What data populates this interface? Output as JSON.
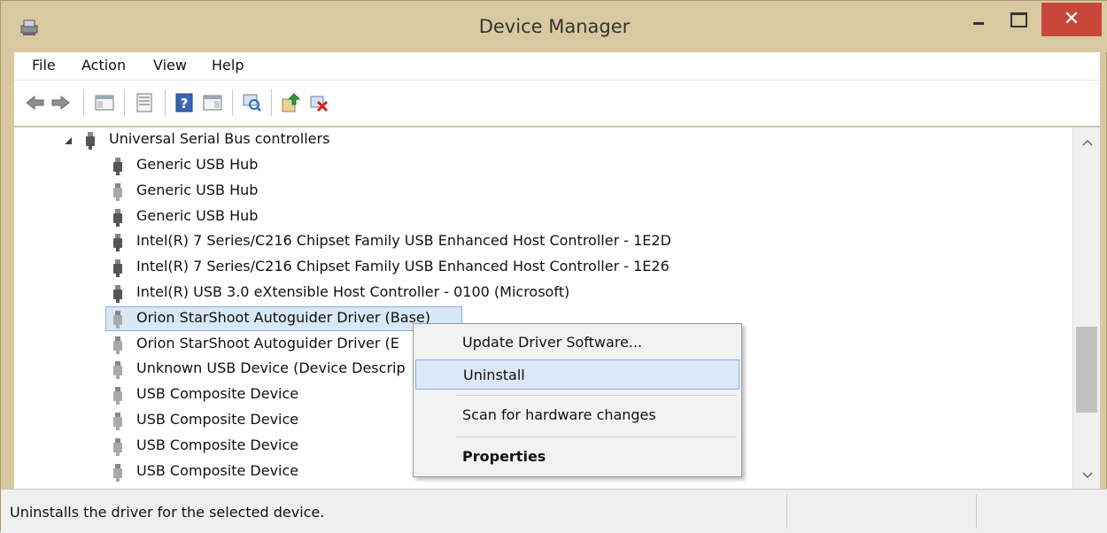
{
  "window": {
    "title": "Device Manager",
    "close_glyph": "✕"
  },
  "menu": [
    "File",
    "Action",
    "View",
    "Help"
  ],
  "toolbar": {
    "icons": [
      "back-icon",
      "forward-icon",
      "show-hide-console-tree-icon",
      "properties-icon",
      "help-icon",
      "action-pane-icon",
      "scan-hardware-icon",
      "update-driver-icon",
      "uninstall-icon"
    ]
  },
  "tree": {
    "category": "Universal Serial Bus controllers",
    "items": [
      "Generic USB Hub",
      "Generic USB Hub",
      "Generic USB Hub",
      "Intel(R) 7 Series/C216 Chipset Family USB Enhanced Host Controller - 1E2D",
      "Intel(R) 7 Series/C216 Chipset Family USB Enhanced Host Controller - 1E26",
      "Intel(R) USB 3.0 eXtensible Host Controller - 0100 (Microsoft)",
      "Orion StarShoot Autoguider Driver (Base)",
      "Orion StarShoot Autoguider Driver (E",
      "Unknown USB Device (Device Descrip",
      "USB Composite Device",
      "USB Composite Device",
      "USB Composite Device",
      "USB Composite Device"
    ],
    "selected_index": 6
  },
  "context_menu": {
    "items": [
      "Update Driver Software...",
      "Uninstall",
      "Scan for hardware changes",
      "Properties"
    ],
    "highlighted": "Uninstall",
    "default_bold": "Properties"
  },
  "status": {
    "text": "Uninstalls the driver for the selected device."
  },
  "colors": {
    "frame": "#d8c9a0",
    "close_button": "#c94739",
    "selection": "#d9e8f6",
    "selection_border": "#7fb2e3"
  }
}
